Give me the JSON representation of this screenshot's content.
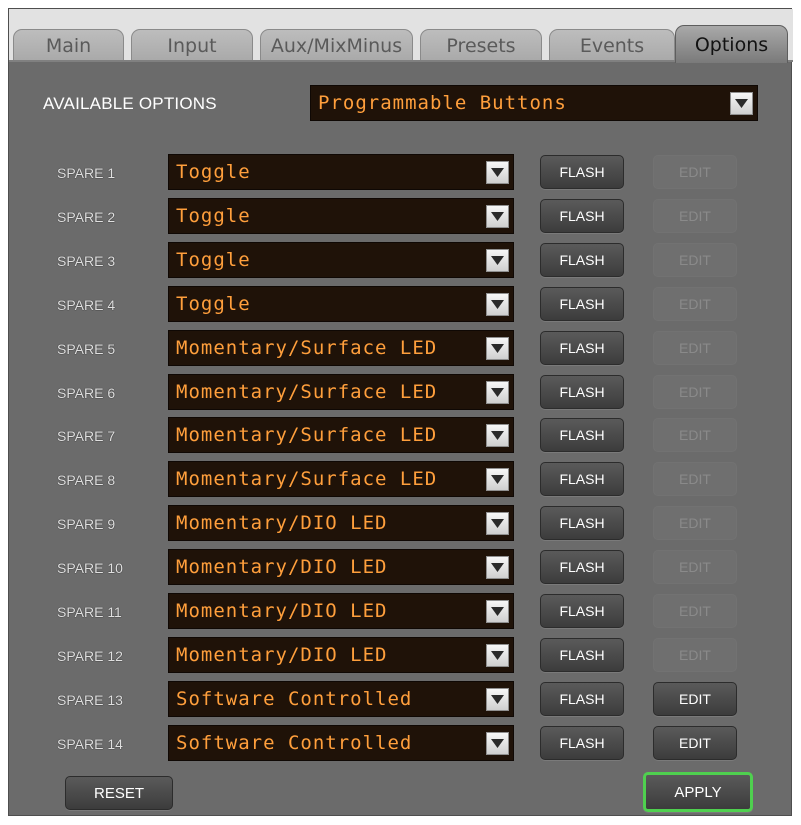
{
  "tabs": [
    {
      "label": "Main",
      "active": false
    },
    {
      "label": "Input",
      "active": false
    },
    {
      "label": "Aux/MixMinus",
      "active": false
    },
    {
      "label": "Presets",
      "active": false
    },
    {
      "label": "Events",
      "active": false
    },
    {
      "label": "Options",
      "active": true
    }
  ],
  "available_options": {
    "label": "AVAILABLE OPTIONS",
    "value": "Programmable Buttons"
  },
  "rows": [
    {
      "label": "SPARE 1",
      "value": "Toggle",
      "flash": "FLASH",
      "edit": "EDIT",
      "edit_enabled": false
    },
    {
      "label": "SPARE 2",
      "value": "Toggle",
      "flash": "FLASH",
      "edit": "EDIT",
      "edit_enabled": false
    },
    {
      "label": "SPARE 3",
      "value": "Toggle",
      "flash": "FLASH",
      "edit": "EDIT",
      "edit_enabled": false
    },
    {
      "label": "SPARE 4",
      "value": "Toggle",
      "flash": "FLASH",
      "edit": "EDIT",
      "edit_enabled": false
    },
    {
      "label": "SPARE 5",
      "value": "Momentary/Surface LED",
      "flash": "FLASH",
      "edit": "EDIT",
      "edit_enabled": false
    },
    {
      "label": "SPARE 6",
      "value": "Momentary/Surface LED",
      "flash": "FLASH",
      "edit": "EDIT",
      "edit_enabled": false
    },
    {
      "label": "SPARE 7",
      "value": "Momentary/Surface LED",
      "flash": "FLASH",
      "edit": "EDIT",
      "edit_enabled": false
    },
    {
      "label": "SPARE 8",
      "value": "Momentary/Surface LED",
      "flash": "FLASH",
      "edit": "EDIT",
      "edit_enabled": false
    },
    {
      "label": "SPARE 9",
      "value": "Momentary/DIO LED",
      "flash": "FLASH",
      "edit": "EDIT",
      "edit_enabled": false
    },
    {
      "label": "SPARE 10",
      "value": "Momentary/DIO LED",
      "flash": "FLASH",
      "edit": "EDIT",
      "edit_enabled": false
    },
    {
      "label": "SPARE 11",
      "value": "Momentary/DIO LED",
      "flash": "FLASH",
      "edit": "EDIT",
      "edit_enabled": false
    },
    {
      "label": "SPARE 12",
      "value": "Momentary/DIO LED",
      "flash": "FLASH",
      "edit": "EDIT",
      "edit_enabled": false
    },
    {
      "label": "SPARE 13",
      "value": "Software Controlled",
      "flash": "FLASH",
      "edit": "EDIT",
      "edit_enabled": true
    },
    {
      "label": "SPARE 14",
      "value": "Software Controlled",
      "flash": "FLASH",
      "edit": "EDIT",
      "edit_enabled": true
    }
  ],
  "footer": {
    "reset": "RESET",
    "apply": "APPLY"
  },
  "colors": {
    "panel": "#6b6b6b",
    "dropdown_bg": "#1f1208",
    "dropdown_text": "#ff9f3c",
    "apply_border": "#4fd04f"
  }
}
